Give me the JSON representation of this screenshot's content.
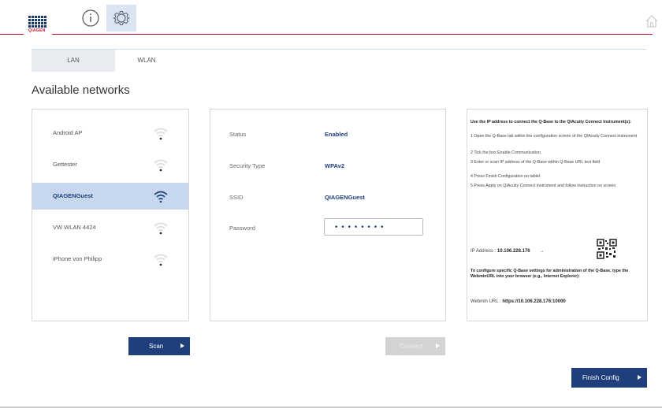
{
  "header": {
    "logo_text": "QIAGEN",
    "accent_color": "#c8102e",
    "brand_color": "#1e3f7c",
    "icons": [
      "info-icon",
      "gear-icon",
      "home-icon"
    ]
  },
  "tabs": [
    {
      "label": "LAN"
    },
    {
      "label": "WLAN"
    }
  ],
  "page_title": "Available networks",
  "networks": [
    {
      "name": "Android AP"
    },
    {
      "name": "Gettester"
    },
    {
      "name": "QIAGENGuest"
    },
    {
      "name": "VW WLAN 4424"
    },
    {
      "name": "iPhone von Philipp"
    }
  ],
  "details": {
    "status_label": "Status",
    "status_value": "Enabled",
    "security_label": "Security Type",
    "security_value": "WPAv2",
    "ssid_label": "SSID",
    "ssid_value": "QIAGENGuest",
    "password_label": "Password",
    "password_value": "••••••••"
  },
  "info": {
    "intro": "Use the IP address to connect the Q-Base to the QIAcuity Connect Instrument(s):",
    "step1": "1 Open the Q-Base tab within the configuration screen of the QIAcuity Connect instrument",
    "step2": "2 Tick the box Enable Communication",
    "step3": "3 Enter or scan IP address of the Q-Base within Q-Base URL text field",
    "step4": "4 Press Finish Configuration on tablet",
    "step5": "5 Press Apply on QIAcuity Connect instrument and follow instruction on screen",
    "ip_label": "IP Address :",
    "ip_value": "10.106.228.176",
    "ip_arrow": "→",
    "config_note": "To configure specific Q-Base settings for administration of the Q-Base, type the WebminURL into your browser (e.g., Internet Explorer):",
    "webmin_label": "Webmin URL :",
    "webmin_value": "https://10.106.228.176:10000"
  },
  "buttons": {
    "scan": "Scan",
    "connect": "Connect",
    "finish": "Finish Config"
  }
}
